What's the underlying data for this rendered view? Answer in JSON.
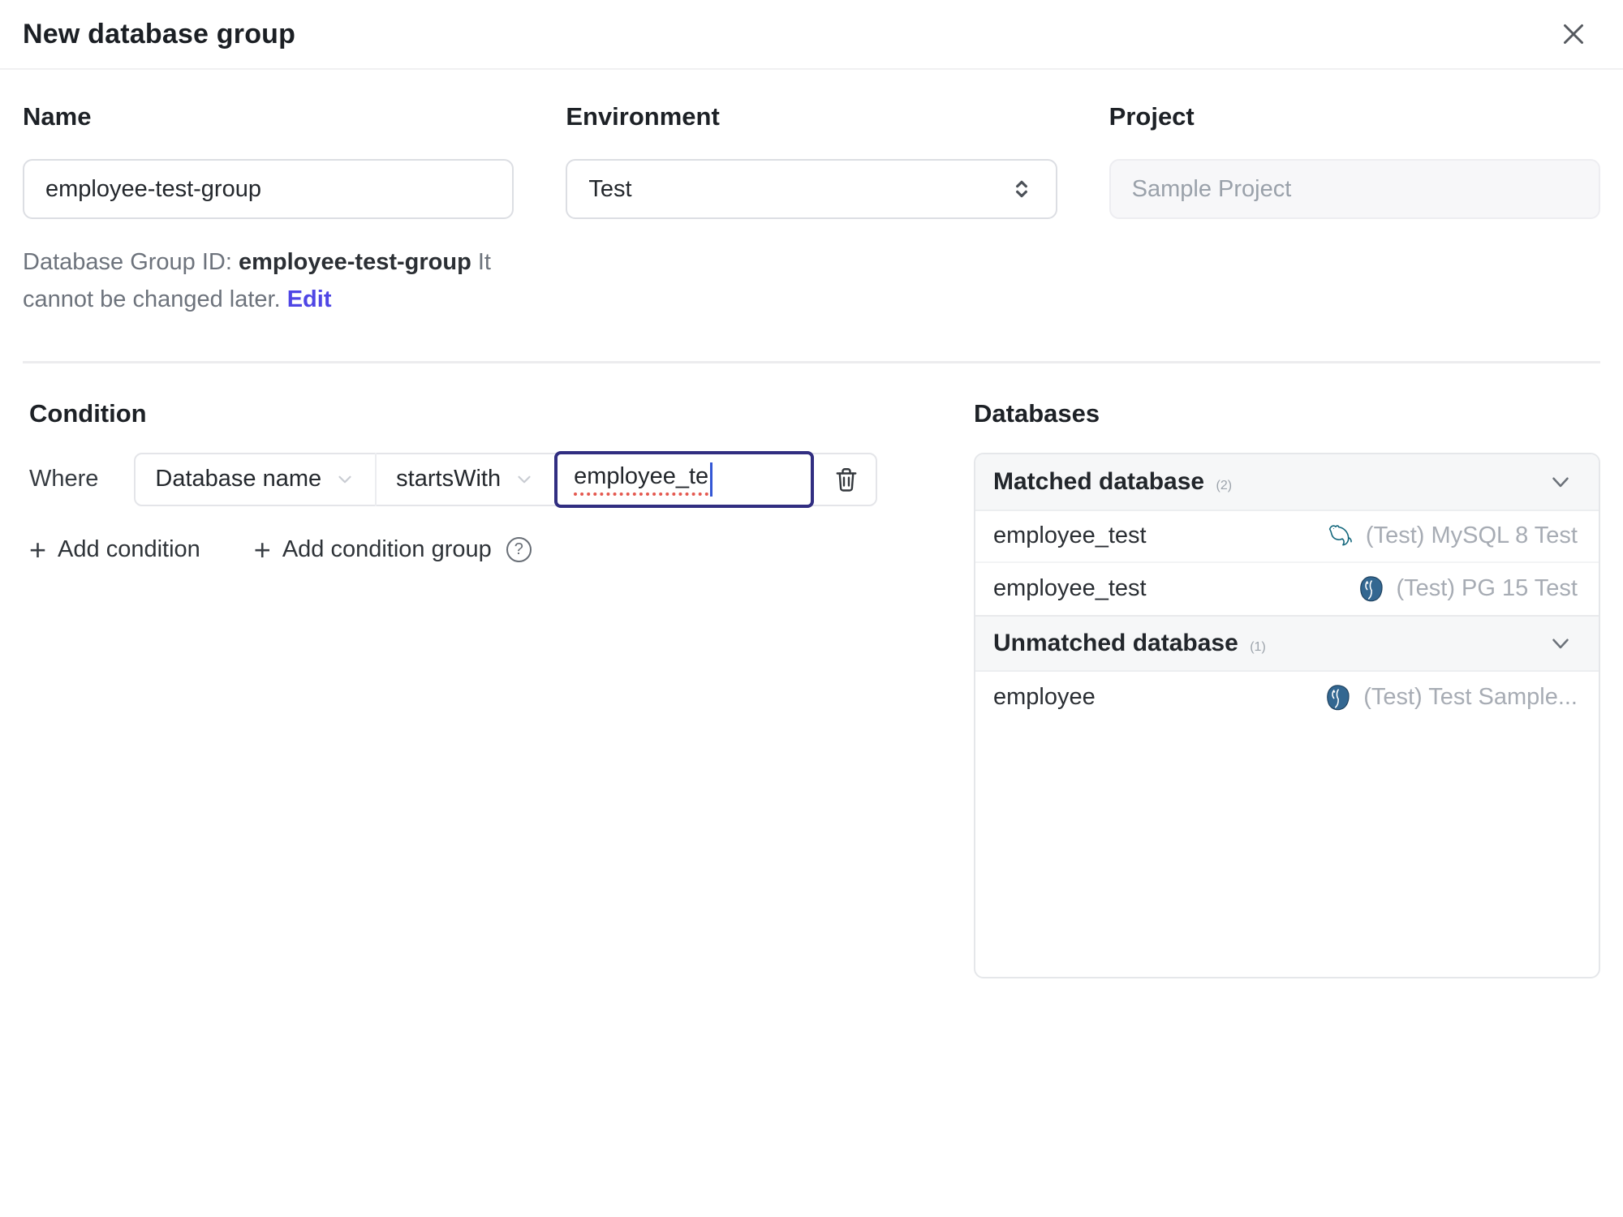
{
  "dialog": {
    "title": "New database group"
  },
  "icons": {
    "plus": "+",
    "help": "?"
  },
  "colors": {
    "accent_link": "#4f46e5",
    "focus_border": "#312e81",
    "spellcheck_underline": "#e4584f",
    "mysql": "#13677c",
    "postgres": "#336791"
  },
  "form": {
    "name": {
      "label": "Name",
      "value": "employee-test-group"
    },
    "environment": {
      "label": "Environment",
      "value": "Test"
    },
    "project": {
      "label": "Project",
      "value": "Sample Project"
    },
    "group_id_help": {
      "prefix": "Database Group ID: ",
      "id": "employee-test-group",
      "suffix": " It cannot be changed later. ",
      "edit_label": "Edit"
    }
  },
  "condition": {
    "heading": "Condition",
    "where_label": "Where",
    "factor": "Database name",
    "operator": "startsWith",
    "value": "employee_te",
    "add_condition": "Add condition",
    "add_condition_group": "Add condition group"
  },
  "databases": {
    "heading": "Databases",
    "sections": [
      {
        "title": "Matched database",
        "count": "(2)",
        "rows": [
          {
            "name": "employee_test",
            "engine": "mysql",
            "instance": "(Test) MySQL 8 Test"
          },
          {
            "name": "employee_test",
            "engine": "postgres",
            "instance": "(Test) PG 15 Test"
          }
        ]
      },
      {
        "title": "Unmatched database",
        "count": "(1)",
        "rows": [
          {
            "name": "employee",
            "engine": "postgres",
            "instance": "(Test) Test Sample..."
          }
        ]
      }
    ]
  }
}
